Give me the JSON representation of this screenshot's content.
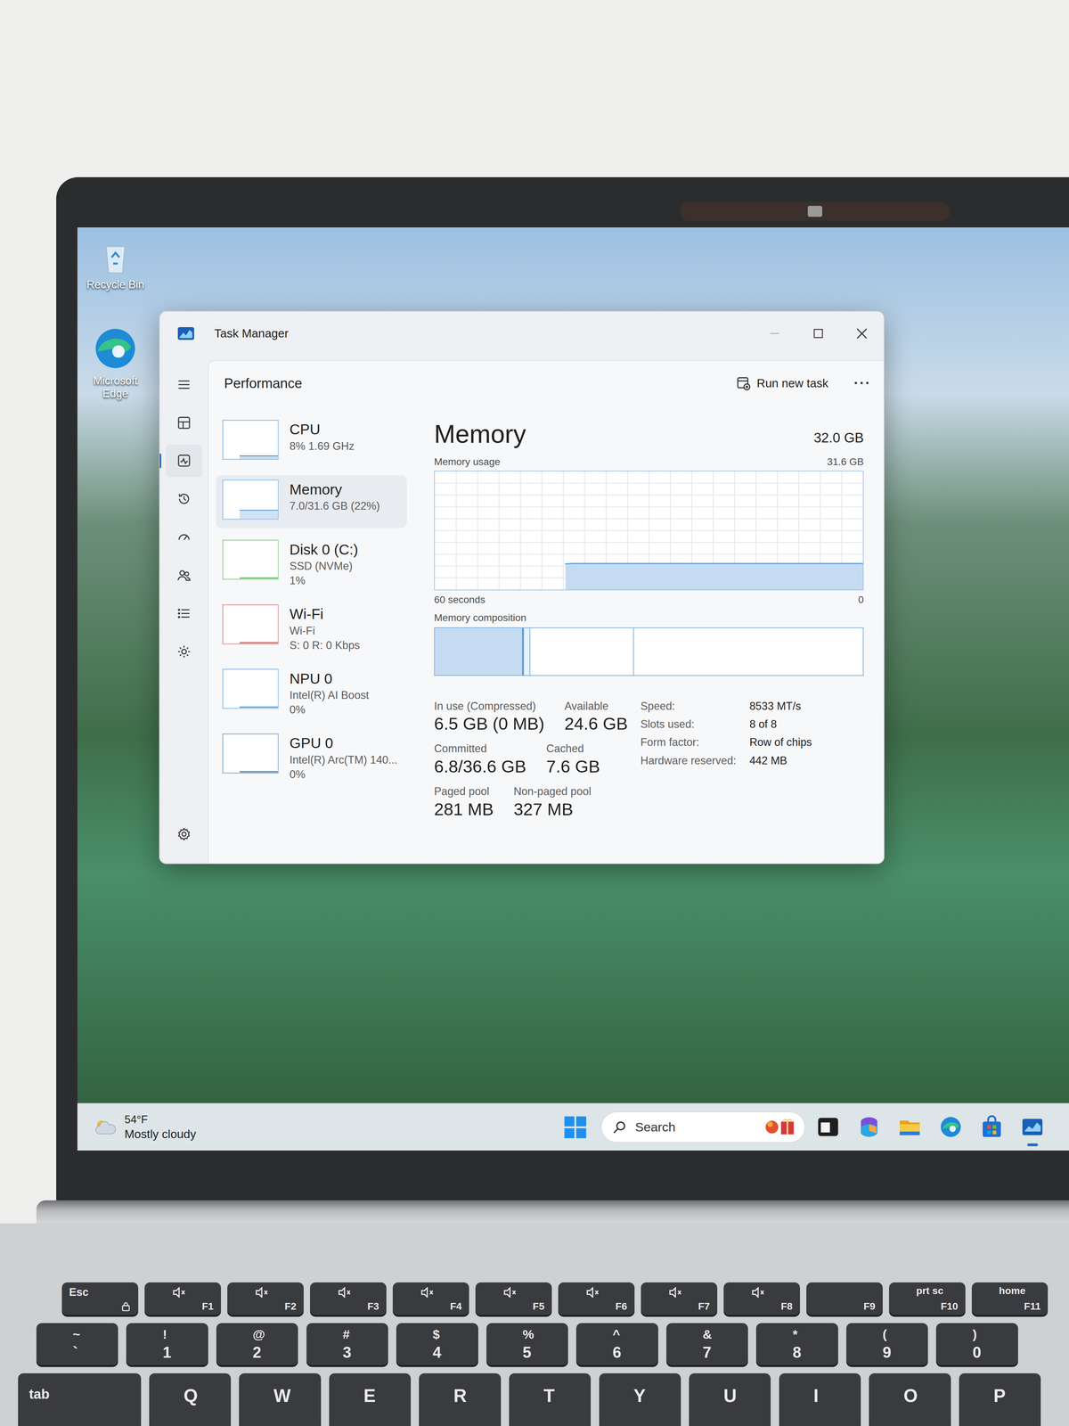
{
  "desktop": {
    "icons": [
      {
        "label": "Recycle Bin",
        "kind": "recycle"
      },
      {
        "label": "Microsoft Edge",
        "kind": "edge"
      }
    ]
  },
  "window": {
    "title": "Task Manager"
  },
  "nav": {
    "items": [
      {
        "kind": "menu",
        "selected": false
      },
      {
        "kind": "processes",
        "selected": false
      },
      {
        "kind": "performance",
        "selected": true
      },
      {
        "kind": "history",
        "selected": false
      },
      {
        "kind": "startup",
        "selected": false
      },
      {
        "kind": "users",
        "selected": false
      },
      {
        "kind": "details",
        "selected": false
      },
      {
        "kind": "services",
        "selected": false
      }
    ],
    "settings": {
      "kind": "settings",
      "selected": false
    }
  },
  "header": {
    "title": "Performance",
    "run_task": "Run new task",
    "more": "···"
  },
  "sidebar": {
    "items": [
      {
        "title": "CPU",
        "lines": [
          "8% 1.69 GHz"
        ],
        "selected": false,
        "level": 0.08,
        "color": "#3f8fd1"
      },
      {
        "title": "Memory",
        "lines": [
          "7.0/31.6 GB (22%)"
        ],
        "selected": true,
        "level": 0.22,
        "color": "#5b9bd5"
      },
      {
        "title": "Disk 0 (C:)",
        "lines": [
          "SSD (NVMe)",
          "1%"
        ],
        "selected": false,
        "level": 0.01,
        "color": "#4caf50"
      },
      {
        "title": "Wi-Fi",
        "lines": [
          "Wi-Fi",
          "S: 0 R: 0 Kbps"
        ],
        "selected": false,
        "level": 0.02,
        "color": "#c0504d"
      },
      {
        "title": "NPU 0",
        "lines": [
          "Intel(R) AI Boost",
          "0%"
        ],
        "selected": false,
        "level": 0.0,
        "color": "#3f8fd1"
      },
      {
        "title": "GPU 0",
        "lines": [
          "Intel(R) Arc(TM) 140...",
          "0%"
        ],
        "selected": false,
        "level": 0.01,
        "color": "#2f6fb0"
      }
    ]
  },
  "memory": {
    "title": "Memory",
    "total": "32.0 GB",
    "usage_label": "Memory usage",
    "usage_max": "31.6 GB",
    "chart": {
      "max": 31.6,
      "points": 60,
      "values": [
        6.9,
        7.0,
        7.0,
        7.0,
        7.0,
        7.0,
        7.0,
        7.0,
        7.0,
        7.0,
        7.0,
        7.0,
        7.0,
        7.0,
        7.0,
        7.0,
        7.0,
        7.0,
        7.0,
        7.0,
        7.0,
        7.0,
        7.0,
        7.0,
        7.0,
        7.0,
        7.0,
        7.0,
        7.0,
        7.0,
        7.0,
        7.0,
        7.0,
        7.0,
        7.0,
        7.0,
        7.0,
        7.0,
        7.0,
        7.0,
        7.0,
        7.0
      ]
    },
    "time_left": "60 seconds",
    "time_right": "0",
    "composition_label": "Memory composition",
    "composition": [
      {
        "kind": "in-use",
        "level": 0.204
      },
      {
        "kind": "modified",
        "level": 0.017
      },
      {
        "kind": "standby",
        "level": 0.242
      },
      {
        "kind": "free",
        "level": 0.537
      }
    ],
    "stats": [
      [
        {
          "label": "In use (Compressed)",
          "value": "6.5 GB (0 MB)"
        },
        {
          "label": "Available",
          "value": "24.6 GB"
        }
      ],
      [
        {
          "label": "Committed",
          "value": "6.8/36.6 GB"
        },
        {
          "label": "Cached",
          "value": "7.6 GB"
        }
      ],
      [
        {
          "label": "Paged pool",
          "value": "281 MB"
        },
        {
          "label": "Non-paged pool",
          "value": "327 MB"
        }
      ]
    ],
    "details": [
      {
        "label": "Speed:",
        "value": "8533 MT/s"
      },
      {
        "label": "Slots used:",
        "value": "8 of 8"
      },
      {
        "label": "Form factor:",
        "value": "Row of chips"
      },
      {
        "label": "Hardware reserved:",
        "value": "442 MB"
      }
    ]
  },
  "taskbar": {
    "weather": {
      "temp": "54°F",
      "condition": "Mostly cloudy"
    },
    "search": {
      "label": "Search"
    },
    "apps": [
      {
        "kind": "terminal",
        "active": false
      },
      {
        "kind": "m365",
        "active": false
      },
      {
        "kind": "explorer",
        "active": false
      },
      {
        "kind": "edge",
        "active": false
      },
      {
        "kind": "store",
        "active": false
      },
      {
        "kind": "taskmgr",
        "active": true
      }
    ]
  },
  "keyboard": {
    "rows": [
      [
        {
          "kind": "esc",
          "label": "Esc"
        },
        {
          "kind": "fn",
          "label": "F1"
        },
        {
          "kind": "fn",
          "label": "F2"
        },
        {
          "kind": "fn",
          "label": "F3"
        },
        {
          "kind": "fn",
          "label": "F4"
        },
        {
          "kind": "fn",
          "label": "F5"
        },
        {
          "kind": "fn",
          "label": "F6"
        },
        {
          "kind": "fn",
          "label": "F7"
        },
        {
          "kind": "fn",
          "label": "F8"
        },
        {
          "kind": "plain",
          "label": "F9"
        },
        {
          "kind": "dual",
          "top": "prt sc",
          "bottom": "F10"
        },
        {
          "kind": "dual",
          "top": "home",
          "bottom": "F11"
        }
      ],
      [
        {
          "kind": "dual",
          "top": "~",
          "bottom": "`"
        },
        {
          "kind": "dual",
          "top": "!",
          "bottom": "1"
        },
        {
          "kind": "dual",
          "top": "@",
          "bottom": "2"
        },
        {
          "kind": "dual",
          "top": "#",
          "bottom": "3"
        },
        {
          "kind": "dual",
          "top": "$",
          "bottom": "4"
        },
        {
          "kind": "dual",
          "top": "%",
          "bottom": "5"
        },
        {
          "kind": "dual",
          "top": "^",
          "bottom": "6"
        },
        {
          "kind": "dual",
          "top": "&",
          "bottom": "7"
        },
        {
          "kind": "dual",
          "top": "*",
          "bottom": "8"
        },
        {
          "kind": "dual",
          "top": "(",
          "bottom": "9"
        },
        {
          "kind": "dual",
          "top": ")",
          "bottom": "0"
        }
      ],
      [
        {
          "kind": "left",
          "label": "tab"
        },
        {
          "kind": "single",
          "label": "Q"
        },
        {
          "kind": "single",
          "label": "W"
        },
        {
          "kind": "single",
          "label": "E"
        },
        {
          "kind": "single",
          "label": "R"
        },
        {
          "kind": "single",
          "label": "T"
        },
        {
          "kind": "single",
          "label": "Y"
        },
        {
          "kind": "single",
          "label": "U"
        },
        {
          "kind": "single",
          "label": "I"
        },
        {
          "kind": "single",
          "label": "O"
        },
        {
          "kind": "single",
          "label": "P"
        }
      ]
    ]
  }
}
